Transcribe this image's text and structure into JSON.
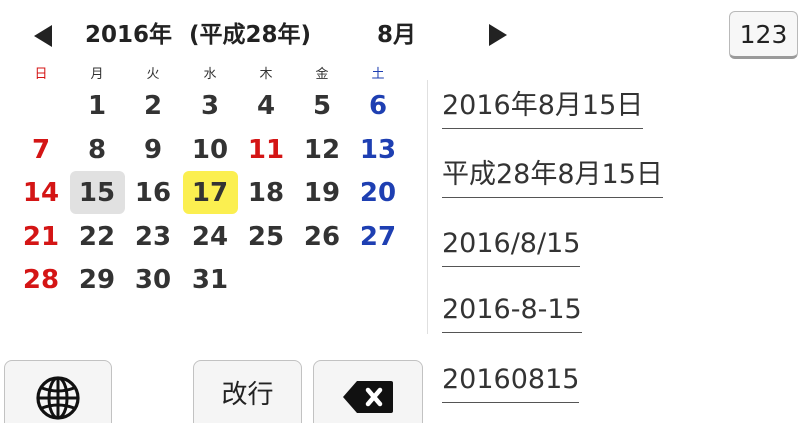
{
  "header": {
    "year": "2016年",
    "era": "(平成28年)",
    "month": "8月",
    "prev_icon": "left-arrow-icon",
    "next_icon": "right-arrow-icon"
  },
  "mode_key": {
    "label": "123"
  },
  "weekdays": [
    "日",
    "月",
    "火",
    "水",
    "木",
    "金",
    "土"
  ],
  "days": [
    [
      "",
      "1",
      "2",
      "3",
      "4",
      "5",
      "6"
    ],
    [
      "7",
      "8",
      "9",
      "10",
      "11",
      "12",
      "13"
    ],
    [
      "14",
      "15",
      "16",
      "17",
      "18",
      "19",
      "20"
    ],
    [
      "21",
      "22",
      "23",
      "24",
      "25",
      "26",
      "27"
    ],
    [
      "28",
      "29",
      "30",
      "31",
      "",
      "",
      ""
    ]
  ],
  "today": "15",
  "selected": "17",
  "holiday": "11",
  "colors": {
    "sunday": "#d41515",
    "saturday": "#1e3fb2",
    "selected_bg": "#fbef50",
    "today_bg": "#e1e1e1"
  },
  "formats": [
    "2016年8月15日",
    "平成28年8月15日",
    "2016/8/15",
    "2016-8-15",
    "20160815"
  ],
  "keys": {
    "globe_icon": "globe-icon",
    "enter_label": "改行",
    "backspace_icon": "backspace-icon"
  }
}
